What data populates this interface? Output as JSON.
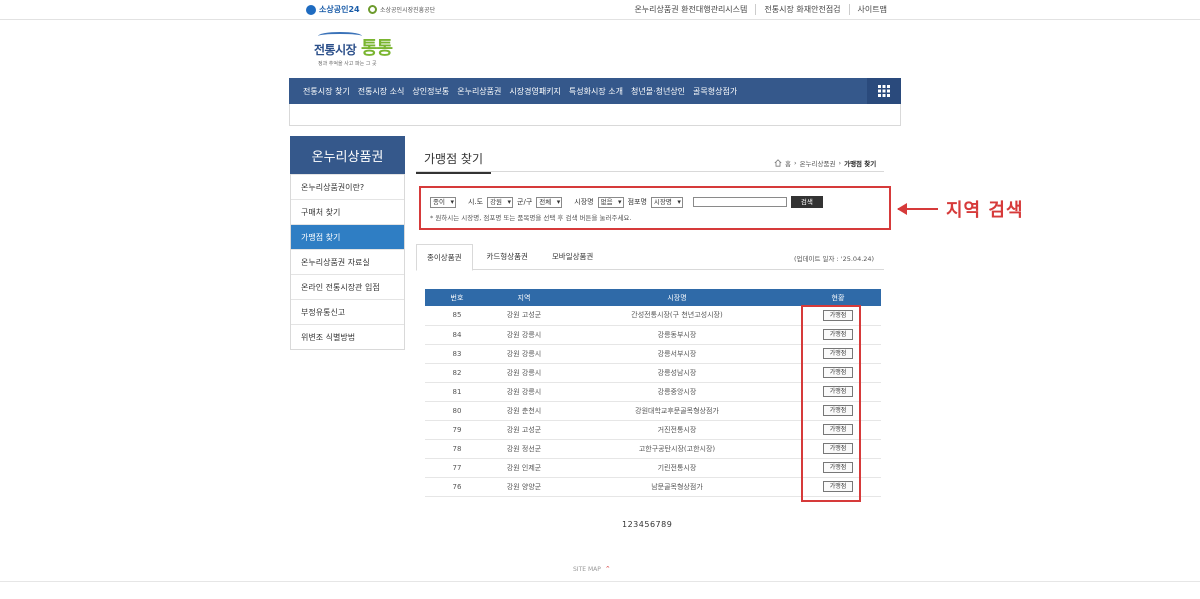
{
  "topbar": {
    "brand1": "소상공인24",
    "brand2": "소상공인시장진흥공단",
    "links": [
      "온누리상품권 환전대행관리시스템",
      "전통시장 화재안전점검",
      "사이트맵"
    ]
  },
  "logo": {
    "text_main": "전통시장",
    "text_accent": "통통",
    "tagline": "정과 추억을 사고 파는 그 곳"
  },
  "gnb": {
    "items": [
      "전통시장 찾기",
      "전통시장 소식",
      "상인정보통",
      "온누리상품권",
      "시장경영패키지",
      "특성화시장 소개",
      "청년몰·청년상인",
      "골목형상점가"
    ]
  },
  "sidebar": {
    "title": "온누리상품권",
    "items": [
      {
        "label": "온누리상품권이란?"
      },
      {
        "label": "구매처 찾기"
      },
      {
        "label": "가맹점 찾기"
      },
      {
        "label": "온누리상품권 자료실"
      },
      {
        "label": "온라인 전통시장관 입점"
      },
      {
        "label": "부정유통신고"
      },
      {
        "label": "위변조 식별방법"
      }
    ],
    "active_index": 2
  },
  "content": {
    "title": "가맹점 찾기",
    "breadcrumb": {
      "home": "홈",
      "level1": "온누리상품권",
      "current": "가맹점 찾기"
    }
  },
  "search": {
    "type_select": "종이",
    "sido_label": "시.도",
    "sido_select": "강원",
    "gungu_label": "군/구",
    "gungu_select": "전체",
    "market_label": "시장명",
    "market_select": "없음",
    "store_label": "점포명",
    "store_select": "시장명",
    "button": "검색",
    "hint": "* 원하시는 시장명, 점포명 또는 품목명을 선택 후 검색 버튼을 눌러주세요."
  },
  "annotation": {
    "text": "지역 검색"
  },
  "tabs": [
    "종이상품권",
    "카드형상품권",
    "모바일상품권"
  ],
  "update": "(업데이트 일자 : '25.04.24)",
  "table": {
    "headers": [
      "번호",
      "지역",
      "시장명",
      "현황"
    ],
    "button_label": "가맹점",
    "rows": [
      {
        "no": "85",
        "region": "강원 고성군",
        "market": "간성전통시장(구 천년고성시장)"
      },
      {
        "no": "84",
        "region": "강원 강릉시",
        "market": "강릉동부시장"
      },
      {
        "no": "83",
        "region": "강원 강릉시",
        "market": "강릉서부시장"
      },
      {
        "no": "82",
        "region": "강원 강릉시",
        "market": "강릉성남시장"
      },
      {
        "no": "81",
        "region": "강원 강릉시",
        "market": "강릉중앙시장"
      },
      {
        "no": "80",
        "region": "강원 춘천시",
        "market": "강원대학교후문골목형상점가"
      },
      {
        "no": "79",
        "region": "강원 고성군",
        "market": "거진전통시장"
      },
      {
        "no": "78",
        "region": "강원 정선군",
        "market": "고한구공탄시장(고한시장)"
      },
      {
        "no": "77",
        "region": "강원 인제군",
        "market": "기린전통시장"
      },
      {
        "no": "76",
        "region": "강원 양양군",
        "market": "남문골목형상점가"
      }
    ]
  },
  "pager": "123456789",
  "footer": {
    "sitemap": "SITE MAP"
  },
  "colors": {
    "navy": "#35588b",
    "active_blue": "#2f7ec4",
    "table_header": "#2f6aa8",
    "highlight_red": "#d63a3a",
    "logo_green": "#7ab530"
  }
}
